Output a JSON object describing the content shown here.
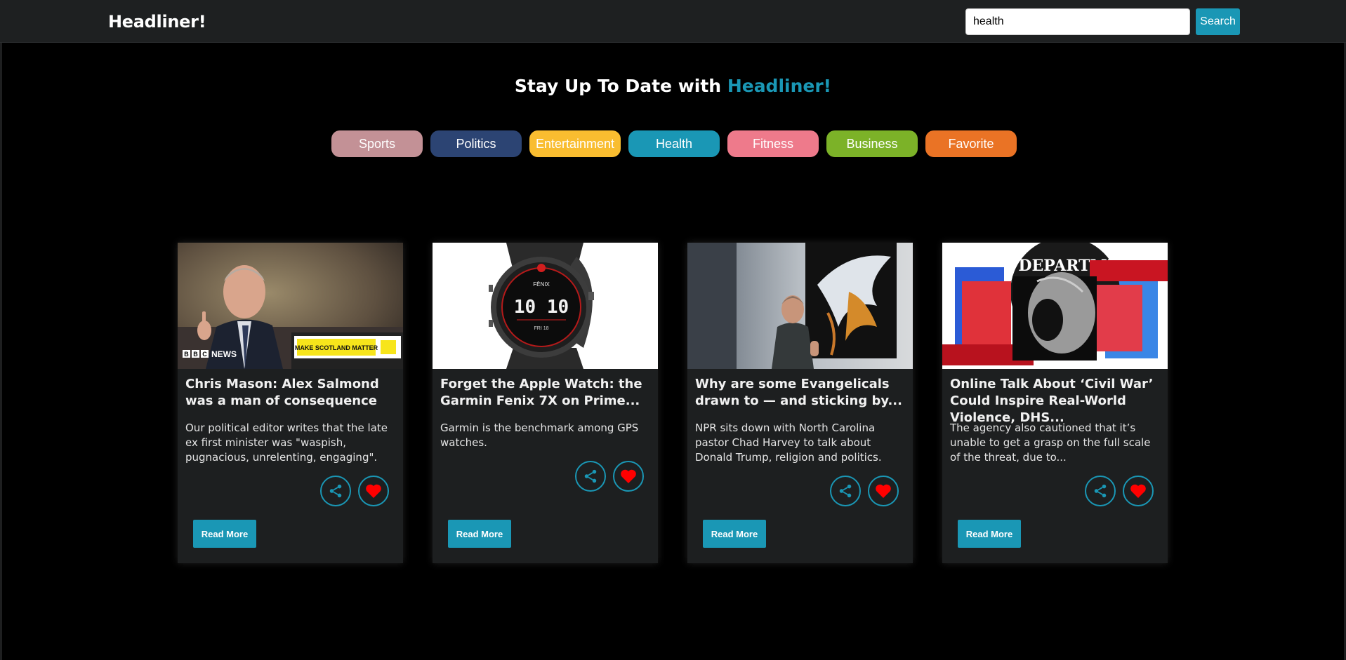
{
  "navbar": {
    "brand": "Headliner!",
    "search_value": "health",
    "search_button": "Search"
  },
  "hero": {
    "prefix": "Stay Up To Date with ",
    "accent": "Headliner!"
  },
  "categories": [
    {
      "label": "Sports",
      "color": "#c39196",
      "text_color": "#ffffff"
    },
    {
      "label": "Politics",
      "color": "#2c4473",
      "text_color": "#ffffff"
    },
    {
      "label": "Entertainment",
      "color": "#f9bd30",
      "text_color": "#ffffff"
    },
    {
      "label": "Health",
      "color": "#1a97b5",
      "text_color": "#ffffff"
    },
    {
      "label": "Fitness",
      "color": "#ee7a8b",
      "text_color": "#ffffff"
    },
    {
      "label": "Business",
      "color": "#7cb228",
      "text_color": "#ffffff"
    },
    {
      "label": "Favorite",
      "color": "#ea7325",
      "text_color": "#ffffff"
    }
  ],
  "articles": [
    {
      "title": "Chris Mason: Alex Salmond was a man of consequence",
      "description": "Our political editor writes that the late ex first minister was \"waspish, pugnacious, unrelenting, engaging\".",
      "image_overlay_text": "BBC NEWS",
      "sign_text": "MAKE SCOTLAND MATTER",
      "read_more": "Read More"
    },
    {
      "title": "Forget the Apple Watch: the Garmin Fenix 7X on Prime...",
      "description": "Garmin is the benchmark among GPS watches.",
      "watch_brand": "FĒNIX",
      "watch_time": "10 10",
      "watch_day": "FRI 18",
      "read_more": "Read More"
    },
    {
      "title": "Why are some Evangelicals drawn to — and sticking by...",
      "description": "NPR sits down with North Carolina pastor Chad Harvey to talk about Donald Trump, religion and politics.",
      "read_more": "Read More"
    },
    {
      "title": "Online Talk About ‘Civil War’ Could Inspire Real-World Violence, DHS...",
      "description": "The agency also cautioned that it’s unable to get a grasp on the full scale of the threat, due to...",
      "seal_text": "DEPARTME",
      "read_more": "Read More"
    }
  ],
  "colors": {
    "accent": "#1a97b5",
    "heart": "#ff0000",
    "card_bg": "#1d1f20",
    "navbar_bg": "#1e2021"
  }
}
